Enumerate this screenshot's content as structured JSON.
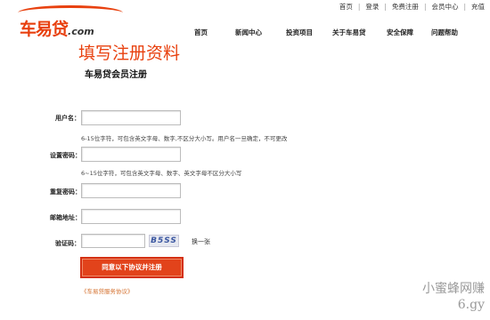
{
  "brand": {
    "logo_text": "车易贷",
    "logo_domain": ".com",
    "accent": "#e8400e"
  },
  "top_links": [
    "首页",
    "登录",
    "免费注册",
    "会员中心",
    "充值"
  ],
  "nav": [
    "首页",
    "新闻中心",
    "投资项目",
    "关于车易贷",
    "安全保障",
    "问题帮助"
  ],
  "page_title": "填写注册资料",
  "form_title": "车易贷会员注册",
  "form": {
    "username_label": "用户名：",
    "username_hint": "6-15位字符，可包含英文字母、数字,不区分大小写。用户名一旦确定，不可更改",
    "password_label": "设置密码：",
    "password_hint": "6~15位字符，可包含英文字母、数字、英文字母不区分大小写",
    "confirm_label": "重复密码：",
    "email_label": "邮箱地址：",
    "captcha_label": "验证码：",
    "captcha_text": "B5SS",
    "refresh_label": "换一张",
    "submit_label": "同意以下协议并注册",
    "agreement_link": "《车易贷服务协议》"
  },
  "watermark": {
    "line1": "小蜜蜂网赚",
    "line2": "6.gy"
  }
}
